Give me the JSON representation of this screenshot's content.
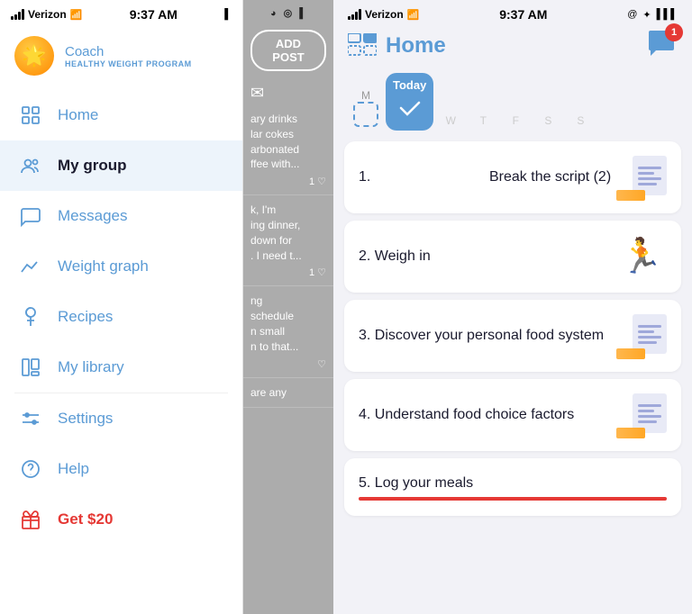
{
  "sidebar": {
    "status_bar": {
      "carrier": "Verizon",
      "time": "9:37 AM",
      "wifi": "📶",
      "battery": "🔋"
    },
    "coach": {
      "label": "Coach",
      "sublabel": "HEALTHY WEIGHT PROGRAM"
    },
    "nav_items": [
      {
        "id": "home",
        "label": "Home",
        "icon": "home"
      },
      {
        "id": "my-group",
        "label": "My group",
        "icon": "group",
        "active": true
      },
      {
        "id": "messages",
        "label": "Messages",
        "icon": "messages"
      },
      {
        "id": "weight-graph",
        "label": "Weight graph",
        "icon": "weight"
      },
      {
        "id": "recipes",
        "label": "Recipes",
        "icon": "recipes"
      },
      {
        "id": "my-library",
        "label": "My library",
        "icon": "library"
      },
      {
        "id": "settings",
        "label": "Settings",
        "icon": "settings"
      },
      {
        "id": "help",
        "label": "Help",
        "icon": "help"
      },
      {
        "id": "get20",
        "label": "Get $20",
        "icon": "gift",
        "special": true
      }
    ]
  },
  "middle_panel": {
    "add_post_label": "ADD POST",
    "feed": [
      {
        "text": "ary drinks\nlar cokes\narbonated\nffee with...",
        "likes": "1 ♡"
      },
      {
        "text": "k, I'm\ning dinner,\ndown for\n. I need t...",
        "likes": "1 ♡"
      },
      {
        "text": "ng\nschedule\nn small\nn to that...",
        "likes": "♡"
      }
    ]
  },
  "main_panel": {
    "status_bar": {
      "carrier": "Verizon",
      "time": "9:37 AM",
      "icons": "@ ✦ 🔋"
    },
    "header": {
      "title": "Home",
      "notification_count": "1"
    },
    "days": [
      {
        "label": "M",
        "today": false
      },
      {
        "label": "Today",
        "today": true
      },
      {
        "label": "W",
        "today": false
      },
      {
        "label": "T",
        "today": false
      },
      {
        "label": "F",
        "today": false
      },
      {
        "label": "S",
        "today": false
      },
      {
        "label": "S",
        "today": false
      }
    ],
    "tasks": [
      {
        "number": "1.",
        "title": "Break the script (2)",
        "icon_type": "checklist-pencil"
      },
      {
        "number": "2.",
        "title": "Weigh in",
        "icon_type": "person-scale"
      },
      {
        "number": "3.",
        "title": "Discover your personal food system",
        "icon_type": "checklist-pencil"
      },
      {
        "number": "4.",
        "title": "Understand food choice factors",
        "icon_type": "checklist-pencil"
      },
      {
        "number": "5.",
        "title": "Log your meals",
        "icon_type": "progress-bar"
      }
    ]
  }
}
